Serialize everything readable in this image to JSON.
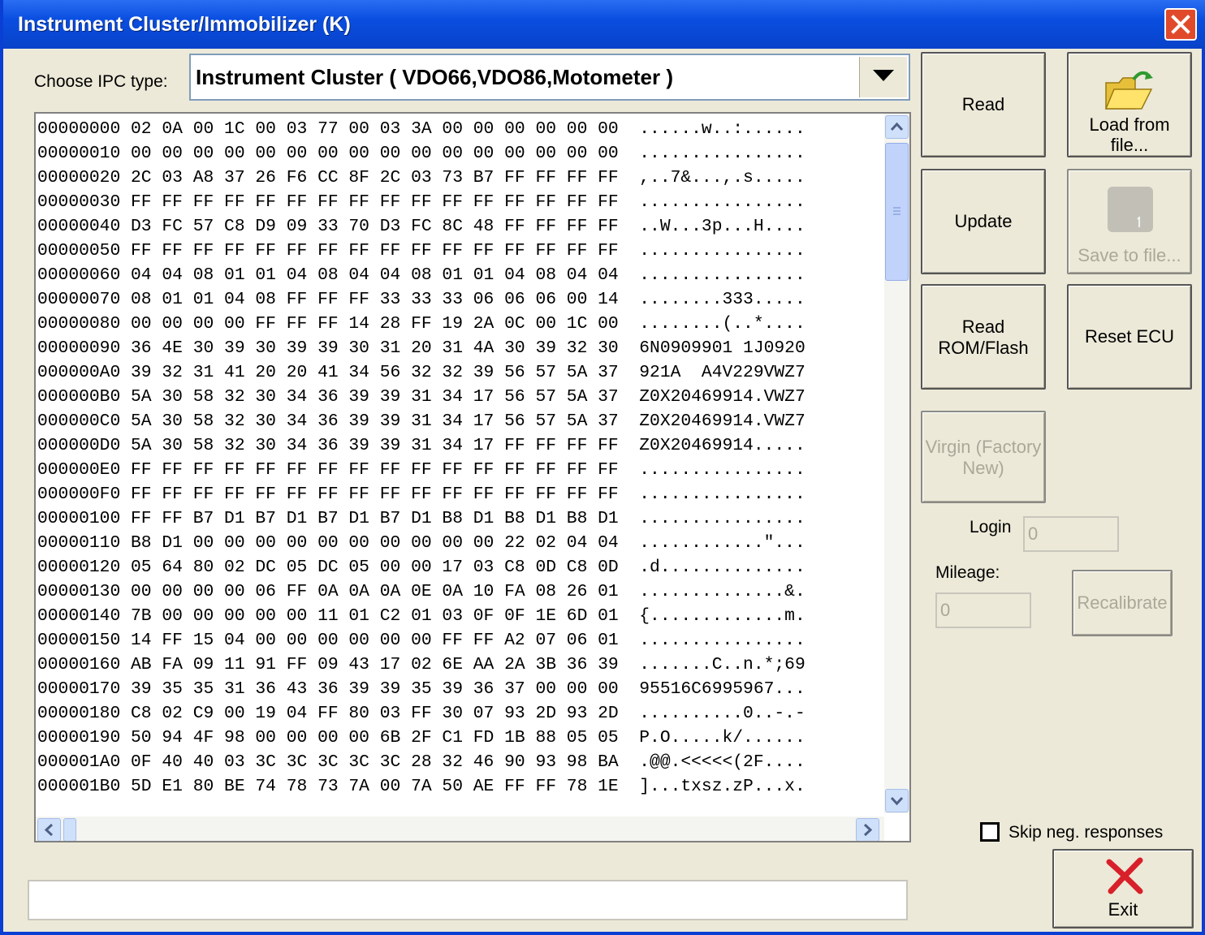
{
  "window": {
    "title": "Instrument Cluster/Immobilizer (K)"
  },
  "ipc": {
    "label": "Choose IPC type:",
    "selected": "Instrument Cluster ( VDO66,VDO86,Motometer )"
  },
  "hex_lines": [
    "00000000 02 0A 00 1C 00 03 77 00 03 3A 00 00 00 00 00 00  ......w..:......",
    "00000010 00 00 00 00 00 00 00 00 00 00 00 00 00 00 00 00  ................",
    "00000020 2C 03 A8 37 26 F6 CC 8F 2C 03 73 B7 FF FF FF FF  ,..7&...,.s.....",
    "00000030 FF FF FF FF FF FF FF FF FF FF FF FF FF FF FF FF  ................",
    "00000040 D3 FC 57 C8 D9 09 33 70 D3 FC 8C 48 FF FF FF FF  ..W...3p...H....",
    "00000050 FF FF FF FF FF FF FF FF FF FF FF FF FF FF FF FF  ................",
    "00000060 04 04 08 01 01 04 08 04 04 08 01 01 04 08 04 04  ................",
    "00000070 08 01 01 04 08 FF FF FF 33 33 33 06 06 06 00 14  ........333.....",
    "00000080 00 00 00 00 FF FF FF 14 28 FF 19 2A 0C 00 1C 00  ........(..*....",
    "00000090 36 4E 30 39 30 39 39 30 31 20 31 4A 30 39 32 30  6N0909901 1J0920",
    "000000A0 39 32 31 41 20 20 41 34 56 32 32 39 56 57 5A 37  921A  A4V229VWZ7",
    "000000B0 5A 30 58 32 30 34 36 39 39 31 34 17 56 57 5A 37  Z0X20469914.VWZ7",
    "000000C0 5A 30 58 32 30 34 36 39 39 31 34 17 56 57 5A 37  Z0X20469914.VWZ7",
    "000000D0 5A 30 58 32 30 34 36 39 39 31 34 17 FF FF FF FF  Z0X20469914.....",
    "000000E0 FF FF FF FF FF FF FF FF FF FF FF FF FF FF FF FF  ................",
    "000000F0 FF FF FF FF FF FF FF FF FF FF FF FF FF FF FF FF  ................",
    "00000100 FF FF B7 D1 B7 D1 B7 D1 B7 D1 B8 D1 B8 D1 B8 D1  ................",
    "00000110 B8 D1 00 00 00 00 00 00 00 00 00 00 22 02 04 04  ............\"...",
    "00000120 05 64 80 02 DC 05 DC 05 00 00 17 03 C8 0D C8 0D  .d..............",
    "00000130 00 00 00 00 06 FF 0A 0A 0A 0E 0A 10 FA 08 26 01  ..............&.",
    "00000140 7B 00 00 00 00 00 11 01 C2 01 03 0F 0F 1E 6D 01  {.............m.",
    "00000150 14 FF 15 04 00 00 00 00 00 00 FF FF A2 07 06 01  ................",
    "00000160 AB FA 09 11 91 FF 09 43 17 02 6E AA 2A 3B 36 39  .......C..n.*;69",
    "00000170 39 35 35 31 36 43 36 39 39 35 39 36 37 00 00 00  95516C6995967...",
    "00000180 C8 02 C9 00 19 04 FF 80 03 FF 30 07 93 2D 93 2D  ..........0..-.-",
    "00000190 50 94 4F 98 00 00 00 00 6B 2F C1 FD 1B 88 05 05  P.O.....k/......",
    "000001A0 0F 40 40 03 3C 3C 3C 3C 3C 28 32 46 90 93 98 BA  .@@.<<<<<(2F....",
    "000001B0 5D E1 80 BE 74 78 73 7A 00 7A 50 AE FF FF 78 1E  ]...txsz.zP...x."
  ],
  "buttons": {
    "read": "Read",
    "load_from_file": [
      "Load from",
      "file..."
    ],
    "update": "Update",
    "save_to_file": "Save to file...",
    "read_rom_flash": [
      "Read",
      "ROM/Flash"
    ],
    "reset_ecu": "Reset ECU",
    "virgin": [
      "Virgin (Factory",
      "New)"
    ],
    "recalibrate": "Recalibrate",
    "exit": "Exit"
  },
  "login": {
    "label": "Login",
    "value": "0"
  },
  "mileage": {
    "label": "Mileage:",
    "value": "0"
  },
  "skip_neg": {
    "label": "Skip neg. responses",
    "checked": false
  },
  "status_text": ""
}
